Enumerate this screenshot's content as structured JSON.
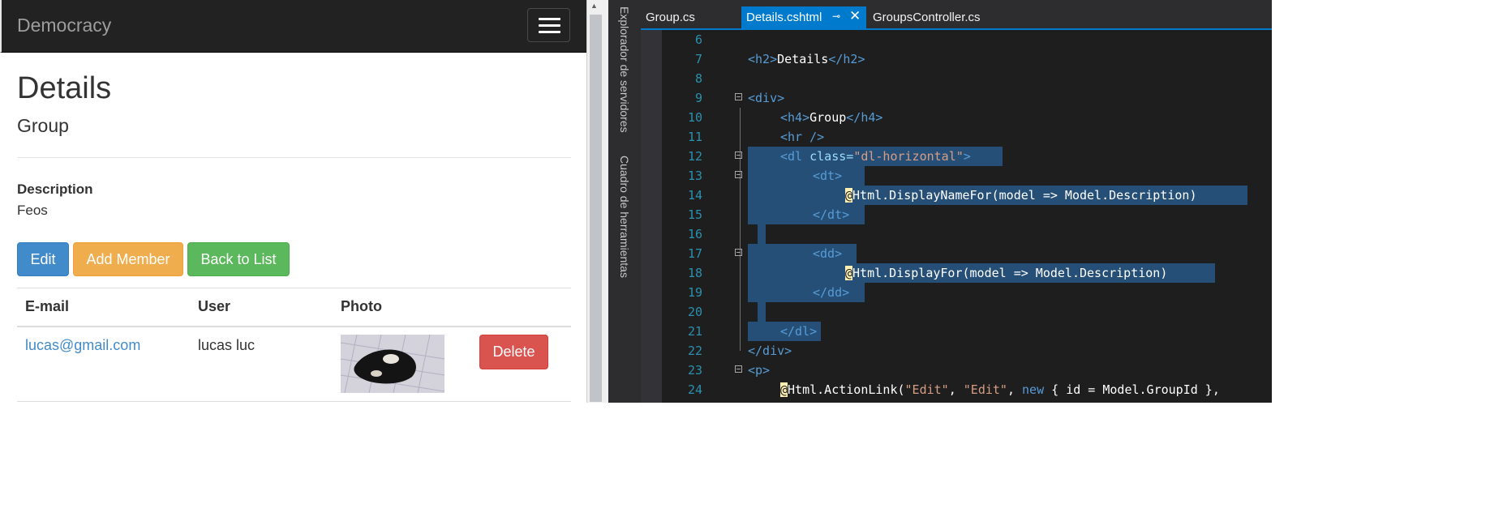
{
  "browser": {
    "brand": "Democracy",
    "title": "Details",
    "subtitle": "Group",
    "description_label": "Description",
    "description_value": "Feos",
    "buttons": {
      "edit": "Edit",
      "add_member": "Add Member",
      "back": "Back to List"
    },
    "table": {
      "headers": [
        "E-mail",
        "User",
        "Photo"
      ],
      "rows": [
        {
          "email": "lucas@gmail.com",
          "user": "lucas luc",
          "delete": "Delete"
        }
      ]
    }
  },
  "ide": {
    "side_tabs": [
      "Explorador de servidores",
      "Cuadro de herramientas"
    ],
    "tabs": [
      {
        "label": "Group.cs",
        "active": false
      },
      {
        "label": "Details.cshtml",
        "active": true
      },
      {
        "label": "GroupsController.cs",
        "active": false
      }
    ],
    "line_numbers": [
      "6",
      "7",
      "8",
      "9",
      "10",
      "11",
      "12",
      "13",
      "14",
      "15",
      "16",
      "17",
      "18",
      "19",
      "20",
      "21",
      "22",
      "23",
      "24"
    ],
    "code": {
      "l7_open": "<h2>",
      "l7_text": "Details",
      "l7_close": "</h2>",
      "l9": "<div>",
      "l10_open": "<h4>",
      "l10_text": "Group",
      "l10_close": "</h4>",
      "l11": "<hr />",
      "l12_tag": "<dl ",
      "l12_attr": "class=",
      "l12_str": "\"dl-horizontal\"",
      "l12_end": ">",
      "l13": "<dt>",
      "l14_at": "@",
      "l14_code": "Html.DisplayNameFor(model => Model.Description)",
      "l15": "</dt>",
      "l17": "<dd>",
      "l18_at": "@",
      "l18_code": "Html.DisplayFor(model => Model.Description)",
      "l19": "</dd>",
      "l21": "</dl>",
      "l22": "</div>",
      "l23": "<p>",
      "l24_at": "@",
      "l24_a": "Html.ActionLink(",
      "l24_s1": "\"Edit\"",
      "l24_b": ", ",
      "l24_s2": "\"Edit\"",
      "l24_c": ", ",
      "l24_kw": "new",
      "l24_d": " { id = Model.GroupId },"
    }
  },
  "colors": {
    "navbar": "#222222",
    "primary": "#428bca",
    "warning": "#f0ad4e",
    "success": "#5cb85c",
    "danger": "#d9534f",
    "ide_accent": "#007acc",
    "selection": "#264f78"
  }
}
